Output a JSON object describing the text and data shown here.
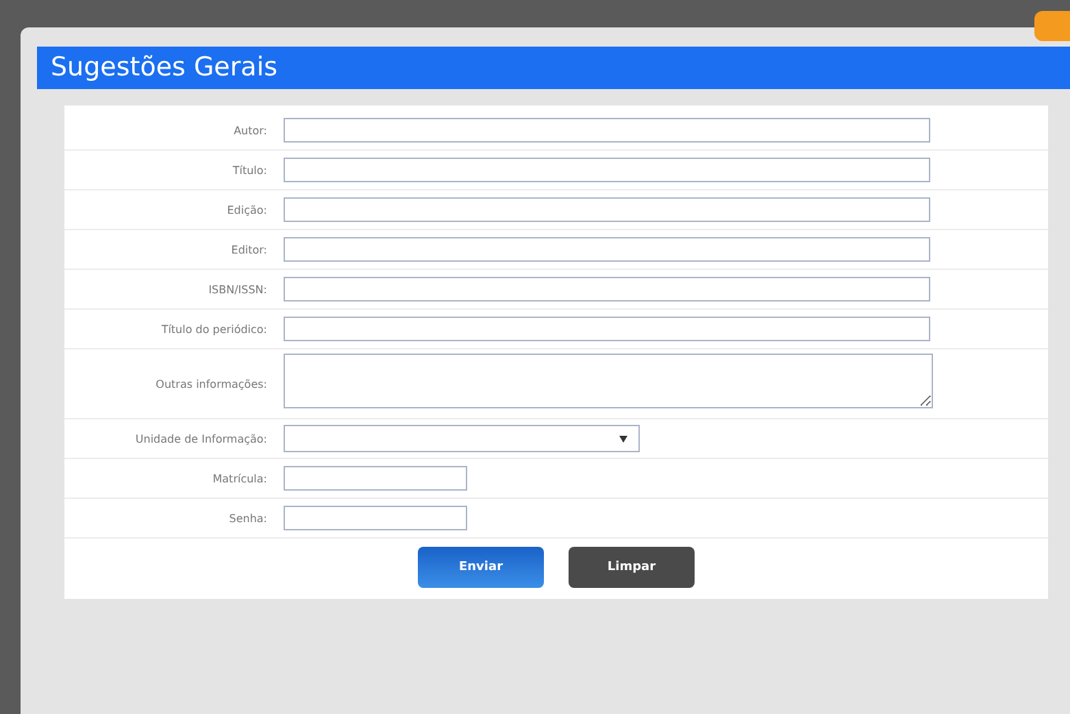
{
  "dialog": {
    "title": "Sugestões Gerais"
  },
  "fields": [
    {
      "label": "Autor:",
      "kind": "text"
    },
    {
      "label": "Título:",
      "kind": "text"
    },
    {
      "label": "Edição:",
      "kind": "text"
    },
    {
      "label": "Editor:",
      "kind": "text"
    },
    {
      "label": "ISBN/ISSN:",
      "kind": "text"
    },
    {
      "label": "Título do periódico:",
      "kind": "text"
    },
    {
      "label": "Outras informações:",
      "kind": "textarea"
    },
    {
      "label": "Unidade de Informação:",
      "kind": "select"
    },
    {
      "label": "Matrícula:",
      "kind": "short"
    },
    {
      "label": "Senha:",
      "kind": "short"
    }
  ],
  "buttons": [
    {
      "label": "Enviar",
      "kind": "primary"
    },
    {
      "label": "Limpar",
      "kind": "secondary"
    }
  ]
}
